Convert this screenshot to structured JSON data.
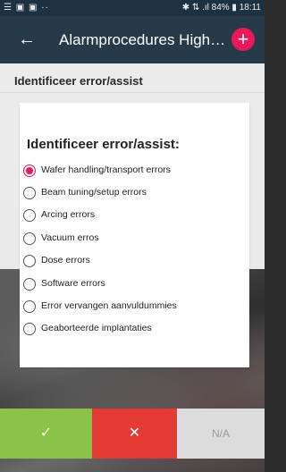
{
  "status_bar": {
    "left_icons": "☰ ▣ ▣ ··",
    "right_info": "✱ ⇅ .ıl 84% ▮ 18:11"
  },
  "app_bar": {
    "title": "Alarmprocedures High…",
    "back_icon": "←",
    "add_icon": "+"
  },
  "section": {
    "title": "Identificeer error/assist"
  },
  "card": {
    "question": "Identificeer error/assist:",
    "options": [
      {
        "label": "Wafer handling/transport errors",
        "selected": true
      },
      {
        "label": "Beam tuning/setup errors",
        "selected": false
      },
      {
        "label": "Arcing errors",
        "selected": false
      },
      {
        "label": "Vacuum erros",
        "selected": false
      },
      {
        "label": "Dose errors",
        "selected": false
      },
      {
        "label": "Software errors",
        "selected": false
      },
      {
        "label": "Error vervangen aanvuldummies",
        "selected": false
      },
      {
        "label": "Geaborteerde implantaties",
        "selected": false
      }
    ]
  },
  "buttons": {
    "confirm_glyph": "✓",
    "cancel_glyph": "✕",
    "na_label": "N/A"
  },
  "colors": {
    "appbar": "#263a4a",
    "accent": "#e8185b",
    "confirm": "#8bc34a",
    "cancel": "#e53935",
    "na": "#dcdcdc"
  }
}
